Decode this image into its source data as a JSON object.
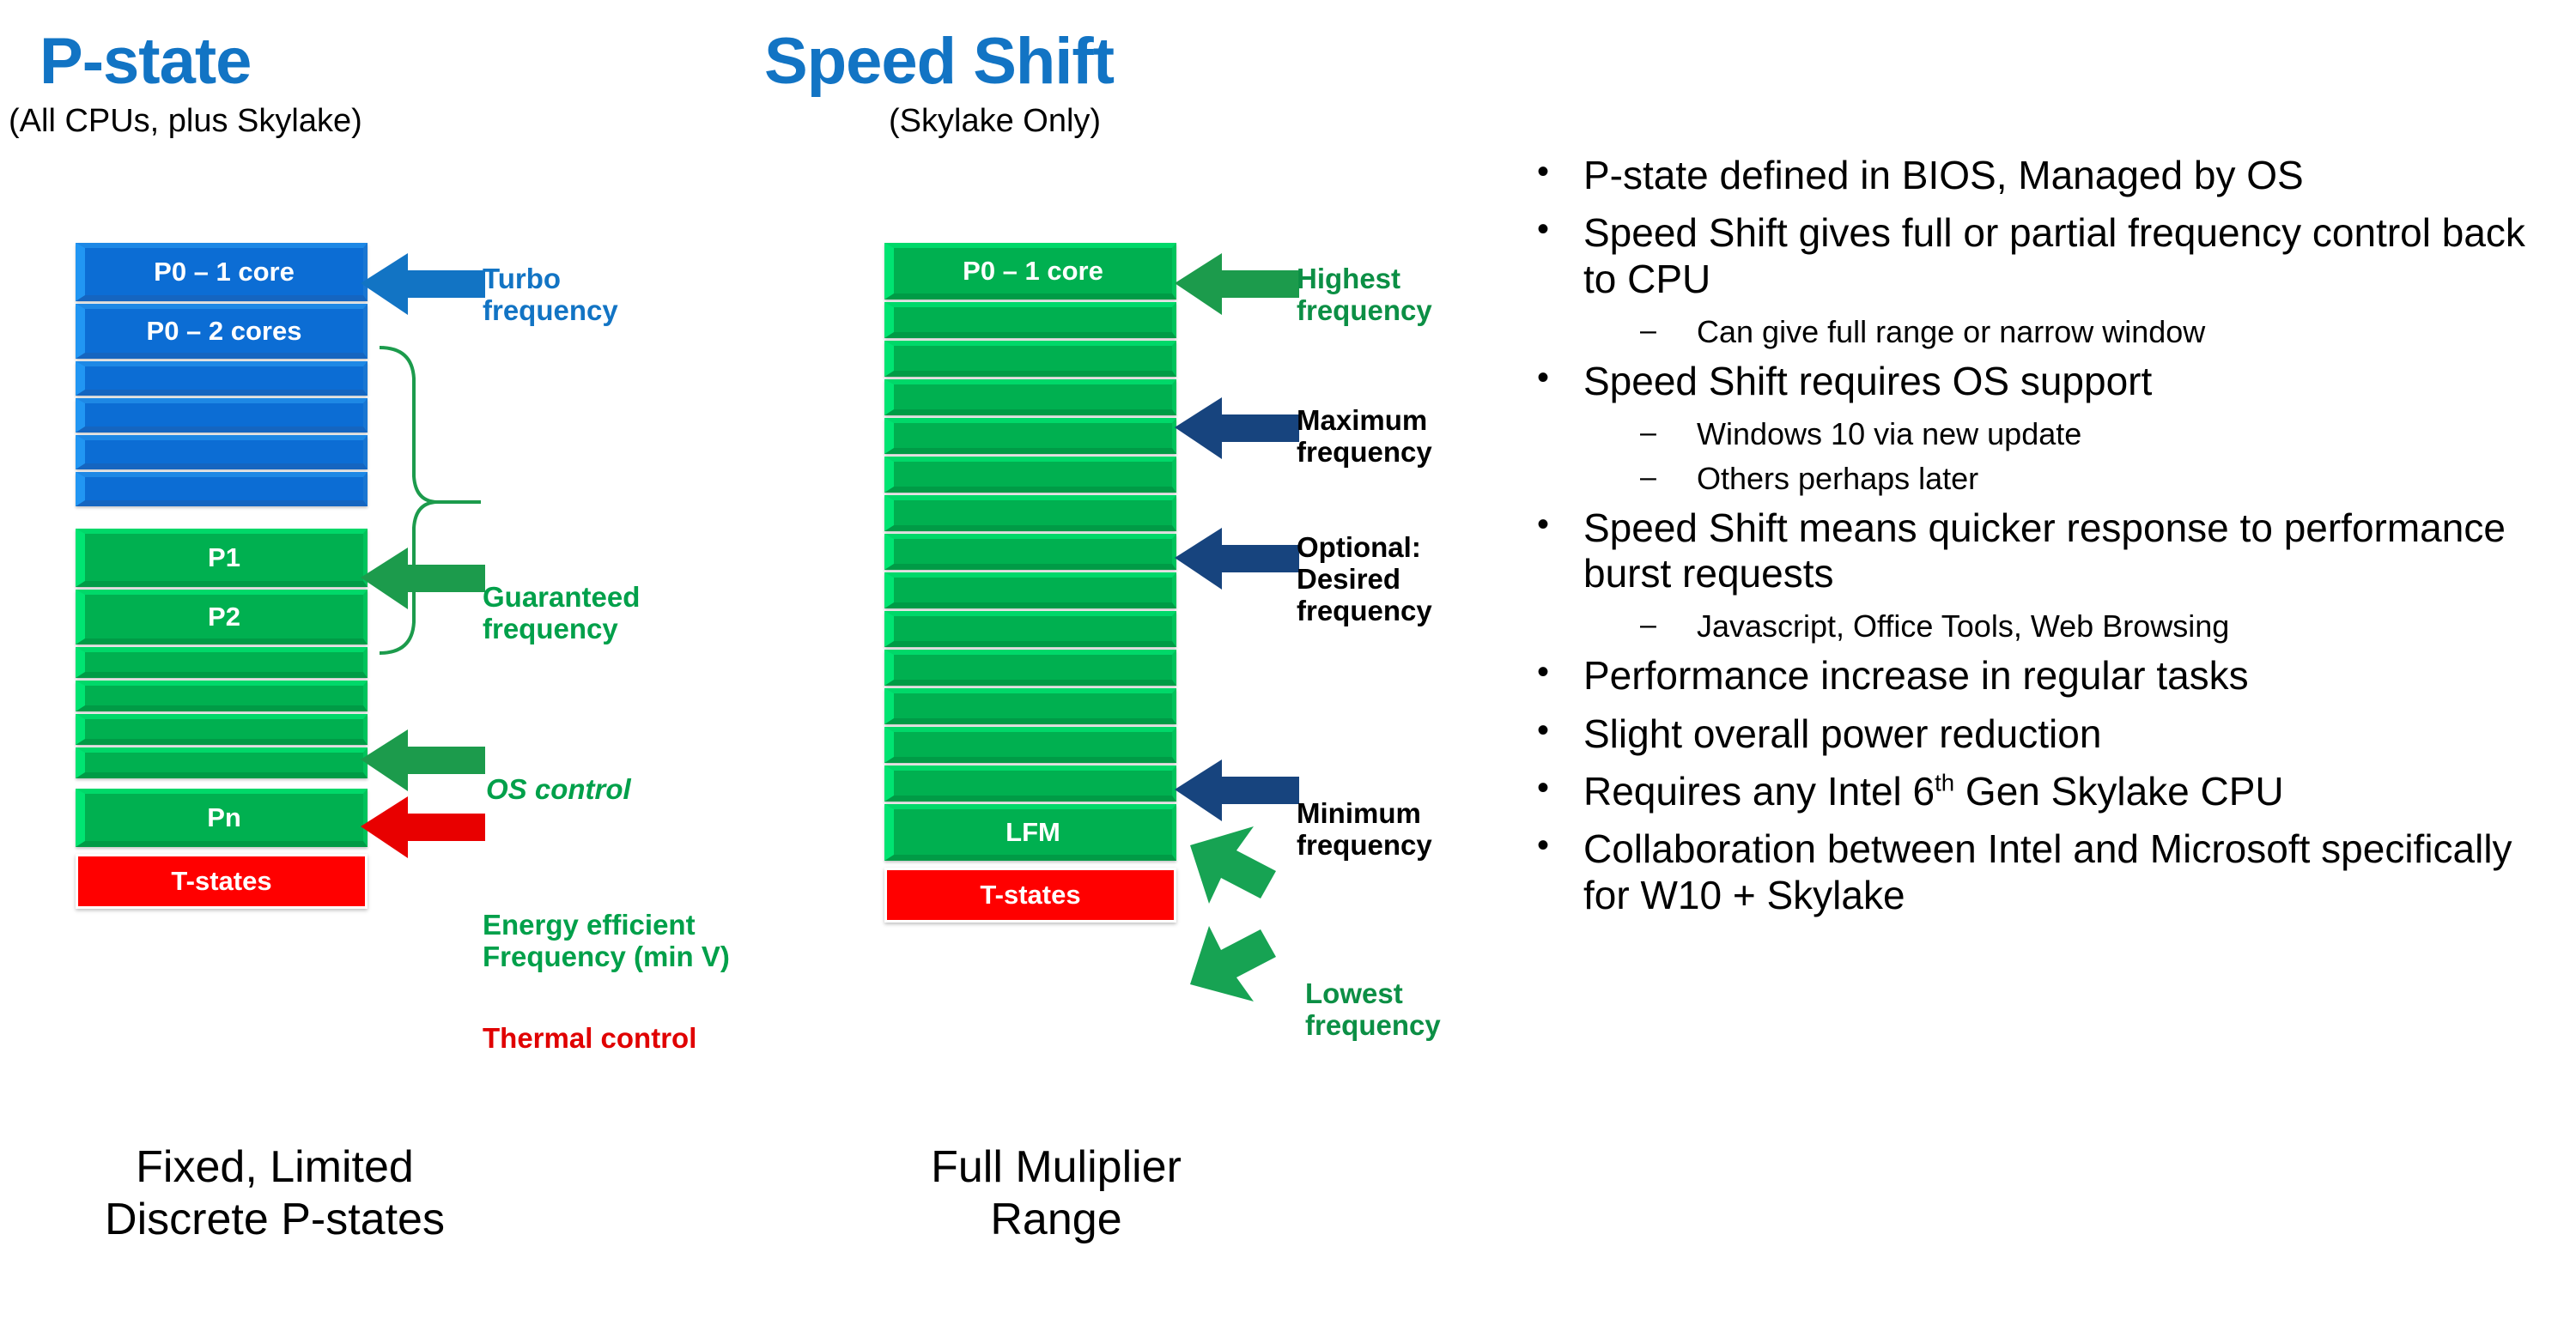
{
  "columns": {
    "left": {
      "title": "P-state",
      "subtitle": "(All CPUs, plus Skylake)",
      "caption": "Fixed, Limited\nDiscrete P-states",
      "bars": [
        {
          "label": "P0 – 1 core",
          "color": "blue"
        },
        {
          "label": "P0 – 2 cores",
          "color": "blue"
        },
        {
          "label": "",
          "color": "blue"
        },
        {
          "label": "",
          "color": "blue"
        },
        {
          "label": "",
          "color": "blue"
        },
        {
          "label": "",
          "color": "blue"
        },
        {
          "label": "P1",
          "color": "green"
        },
        {
          "label": "P2",
          "color": "green"
        },
        {
          "label": "",
          "color": "green"
        },
        {
          "label": "",
          "color": "green"
        },
        {
          "label": "",
          "color": "green"
        },
        {
          "label": "",
          "color": "green"
        },
        {
          "label": "Pn",
          "color": "green"
        },
        {
          "label": "T-states",
          "color": "red"
        }
      ],
      "callouts": [
        {
          "text": "Turbo\nfrequency",
          "style": "blue"
        },
        {
          "text": "Guaranteed\nfrequency",
          "style": "green"
        },
        {
          "text": "OS control",
          "style": "brace"
        },
        {
          "text": "Energy efficient\nFrequency (min V)",
          "style": "green"
        },
        {
          "text": "Thermal control",
          "style": "red"
        }
      ]
    },
    "middle": {
      "title": "Speed Shift",
      "subtitle": "(Skylake Only)",
      "caption": "Full Muliplier\nRange",
      "bars": [
        {
          "label": "P0 – 1 core",
          "color": "green"
        },
        {
          "label": "",
          "color": "green"
        },
        {
          "label": "",
          "color": "green"
        },
        {
          "label": "",
          "color": "green"
        },
        {
          "label": "",
          "color": "green"
        },
        {
          "label": "",
          "color": "green"
        },
        {
          "label": "",
          "color": "green"
        },
        {
          "label": "",
          "color": "green"
        },
        {
          "label": "",
          "color": "green"
        },
        {
          "label": "",
          "color": "green"
        },
        {
          "label": "",
          "color": "green"
        },
        {
          "label": "",
          "color": "green"
        },
        {
          "label": "",
          "color": "green"
        },
        {
          "label": "",
          "color": "green"
        },
        {
          "label": "LFM",
          "color": "green"
        },
        {
          "label": "T-states",
          "color": "red"
        }
      ],
      "callouts": [
        {
          "text": "Highest\nfrequency",
          "style": "green"
        },
        {
          "text": "Maximum\nfrequency",
          "style": "black"
        },
        {
          "text": "Optional:\nDesired\nfrequency",
          "style": "black"
        },
        {
          "text": "Minimum\nfrequency",
          "style": "black"
        },
        {
          "text": "Lowest\nfrequency",
          "style": "green"
        }
      ]
    }
  },
  "bullets": [
    {
      "level": 1,
      "text": "P-state defined in BIOS, Managed by OS"
    },
    {
      "level": 1,
      "text": "Speed Shift gives full or partial frequency control back to CPU"
    },
    {
      "level": 2,
      "text": "Can give full range or narrow window"
    },
    {
      "level": 1,
      "text": "Speed Shift requires OS support"
    },
    {
      "level": 2,
      "text": "Windows 10 via new update"
    },
    {
      "level": 2,
      "text": "Others perhaps later"
    },
    {
      "level": 1,
      "text": "Speed Shift means quicker response to performance burst requests"
    },
    {
      "level": 2,
      "text": "Javascript, Office Tools, Web Browsing"
    },
    {
      "level": 1,
      "text": "Performance increase in regular tasks"
    },
    {
      "level": 1,
      "text": "Slight overall power reduction"
    },
    {
      "level": 1,
      "text": "Requires any Intel 6<sup>th</sup> Gen Skylake CPU",
      "html": true
    },
    {
      "level": 1,
      "text": "Collaboration between Intel and Microsoft specifically for W10 + Skylake"
    }
  ],
  "bullet_markers": {
    "level1": "•",
    "level2": "–"
  },
  "colors": {
    "title_blue": "#1274C4",
    "bar_blue": "#0C6DD4",
    "bar_green": "#00B050",
    "bar_red": "#FF0000",
    "arrow_blue": "#1274C4",
    "arrow_navy": "#17447E",
    "arrow_green": "#0C9C4E",
    "arrow_red": "#E80000",
    "label_green": "#00A04A",
    "label_red": "#E00000"
  }
}
